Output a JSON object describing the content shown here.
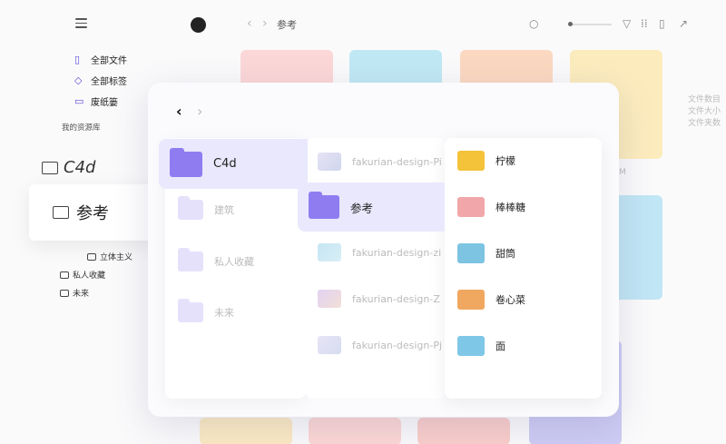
{
  "sidebar": {
    "items": [
      {
        "label": "全部文件",
        "icon": "file-icon"
      },
      {
        "label": "全部标签",
        "icon": "tag-icon"
      },
      {
        "label": "废纸篓",
        "icon": "trash-icon"
      }
    ],
    "library_label": "我的资源库",
    "big_folder_label": "C4d",
    "selected_folder_label": "参考",
    "tree": [
      "立体主义",
      "私人收藏",
      "未来"
    ]
  },
  "topbar": {
    "breadcrumb": "参考",
    "back": "‹",
    "forward": "›"
  },
  "ghost_panel": [
    "文件数目",
    "文件大小",
    "文件夹数"
  ],
  "bg_card_caption": "M",
  "modal": {
    "nav_back": "‹",
    "nav_forward": "›",
    "column1": [
      {
        "label": "C4d",
        "selected": true
      },
      {
        "label": "建筑",
        "selected": false
      },
      {
        "label": "私人收藏",
        "selected": false
      },
      {
        "label": "未来",
        "selected": false
      }
    ],
    "column2": [
      {
        "label": "fakurian-design-Pi",
        "type": "image"
      },
      {
        "label": "参考",
        "type": "folder",
        "selected": true
      },
      {
        "label": "fakurian-design-zi",
        "type": "image"
      },
      {
        "label": "fakurian-design-Z",
        "type": "image"
      },
      {
        "label": "fakurian-design-Pj",
        "type": "image"
      }
    ],
    "column3": [
      {
        "label": "柠檬",
        "color": "#f4c33a"
      },
      {
        "label": "棒棒糖",
        "color": "#f1a7a9"
      },
      {
        "label": "甜筒",
        "color": "#7cc4e2"
      },
      {
        "label": "卷心菜",
        "color": "#f0a860"
      },
      {
        "label": "面",
        "color": "#7fc7e6"
      }
    ]
  },
  "colors": {
    "accent": "#8f7cf0",
    "folder_light": "#e4defc",
    "selection": "#e9e8fc"
  }
}
